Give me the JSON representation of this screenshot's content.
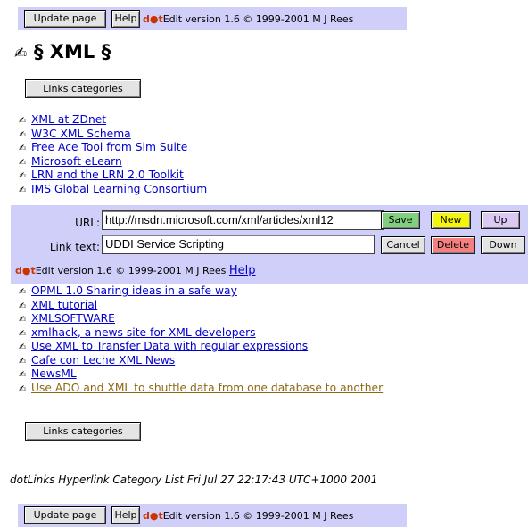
{
  "top_bar": {
    "update_label": "Update page",
    "help_label": "Help",
    "brand_dot": "d●t",
    "version_text": "Edit version 1.6 © 1999-2001 M J Rees"
  },
  "page_title": "§ XML §",
  "title_icon": "✍",
  "links_categories_label": "Links categories",
  "links_before": [
    {
      "label": "XML at ZDnet"
    },
    {
      "label": "W3C XML Schema"
    },
    {
      "label": "Free Ace Tool from Sim Suite"
    },
    {
      "label": "Microsoft eLearn"
    },
    {
      "label": "LRN and the LRN 2.0 Toolkit"
    },
    {
      "label": "IMS Global Learning Consortium"
    }
  ],
  "editor": {
    "url_label": "URL:",
    "url_value": "http://msdn.microsoft.com/xml/articles/xml12",
    "text_label": "Link text:",
    "text_value": "UDDI Service Scripting",
    "save_label": "Save",
    "new_label": "New",
    "up_label": "Up",
    "cancel_label": "Cancel",
    "delete_label": "Delete",
    "down_label": "Down",
    "brand_dot": "d●t",
    "version_text": "Edit version 1.6 © 1999-2001 M J Rees",
    "help_link": "Help",
    "colors": {
      "save": "#7fcf7f",
      "new": "#f5f50a",
      "up": "#dcc8f5",
      "delete": "#f57f7f"
    }
  },
  "links_after": [
    {
      "label": "OPML 1.0 Sharing ideas in a safe way"
    },
    {
      "label": "XML tutorial"
    },
    {
      "label": "XMLSOFTWARE"
    },
    {
      "label": "xmlhack, a news site for XML developers"
    },
    {
      "label": "Use XML to Transfer Data with regular expressions"
    },
    {
      "label": "Cafe con Leche XML News"
    },
    {
      "label": "NewsML"
    },
    {
      "label": "Use ADO and XML to shuttle data from one database to another"
    }
  ],
  "links_categories_label_2": "Links categories",
  "footer_text": "dotLinks Hyperlink Category List Fri Jul 27 22:17:43 UTC+1000 2001",
  "bottom_bar": {
    "update_label": "Update page",
    "help_label": "Help",
    "brand_dot": "d●t",
    "version_text": "Edit version 1.6 © 1999-2001 M J Rees"
  },
  "link_icon": "✍"
}
